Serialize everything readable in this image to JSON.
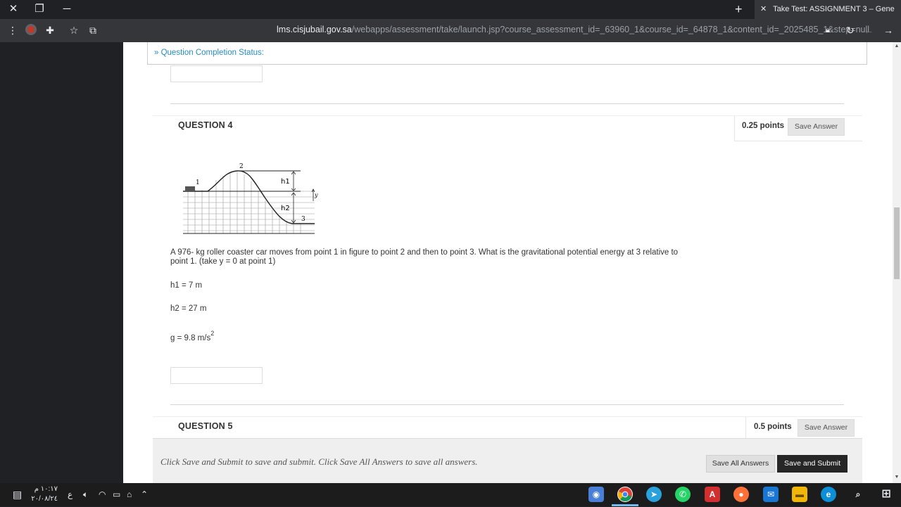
{
  "browser": {
    "tab_title": "Take Test: ASSIGNMENT 3 – Gene",
    "url_host": "lms.cisjubail.gov.sa",
    "url_path": "/webapps/assessment/take/launch.jsp?course_assessment_id=_63960_1&course_id=_64878_1&content_id=_2025485_1&step=null"
  },
  "page": {
    "completion_status_label": "Question Completion Status:",
    "question4": {
      "title": "QUESTION 4",
      "points": "0.25 points",
      "save_label": "Save Answer",
      "figure_labels": {
        "p1": "1",
        "p2": "2",
        "p3": "3",
        "h1": "h1",
        "h2": "h2",
        "y": "y"
      },
      "text_line1": "A 976- kg roller coaster car moves from point 1 in figure to point 2 and then to point 3. What is the gravitational potential energy at 3 relative to",
      "text_line2": "point 1. (take y = 0 at point 1)",
      "h1": "h1 = 7 m",
      "h2": "h2 = 27 m",
      "g": "g = 9.8 m/s",
      "g_sup": "2"
    },
    "question5": {
      "title": "QUESTION 5",
      "points": "0.5 points",
      "save_label": "Save Answer"
    },
    "footer": {
      "message": "Click Save and Submit to save and submit. Click Save All Answers to save all answers.",
      "save_all_label": "Save All Answers",
      "submit_label": "Save and Submit"
    }
  },
  "taskbar": {
    "time": "١٠:١٧ م",
    "date": "٢٠/٠٨/٢٤",
    "lang": "ع"
  }
}
